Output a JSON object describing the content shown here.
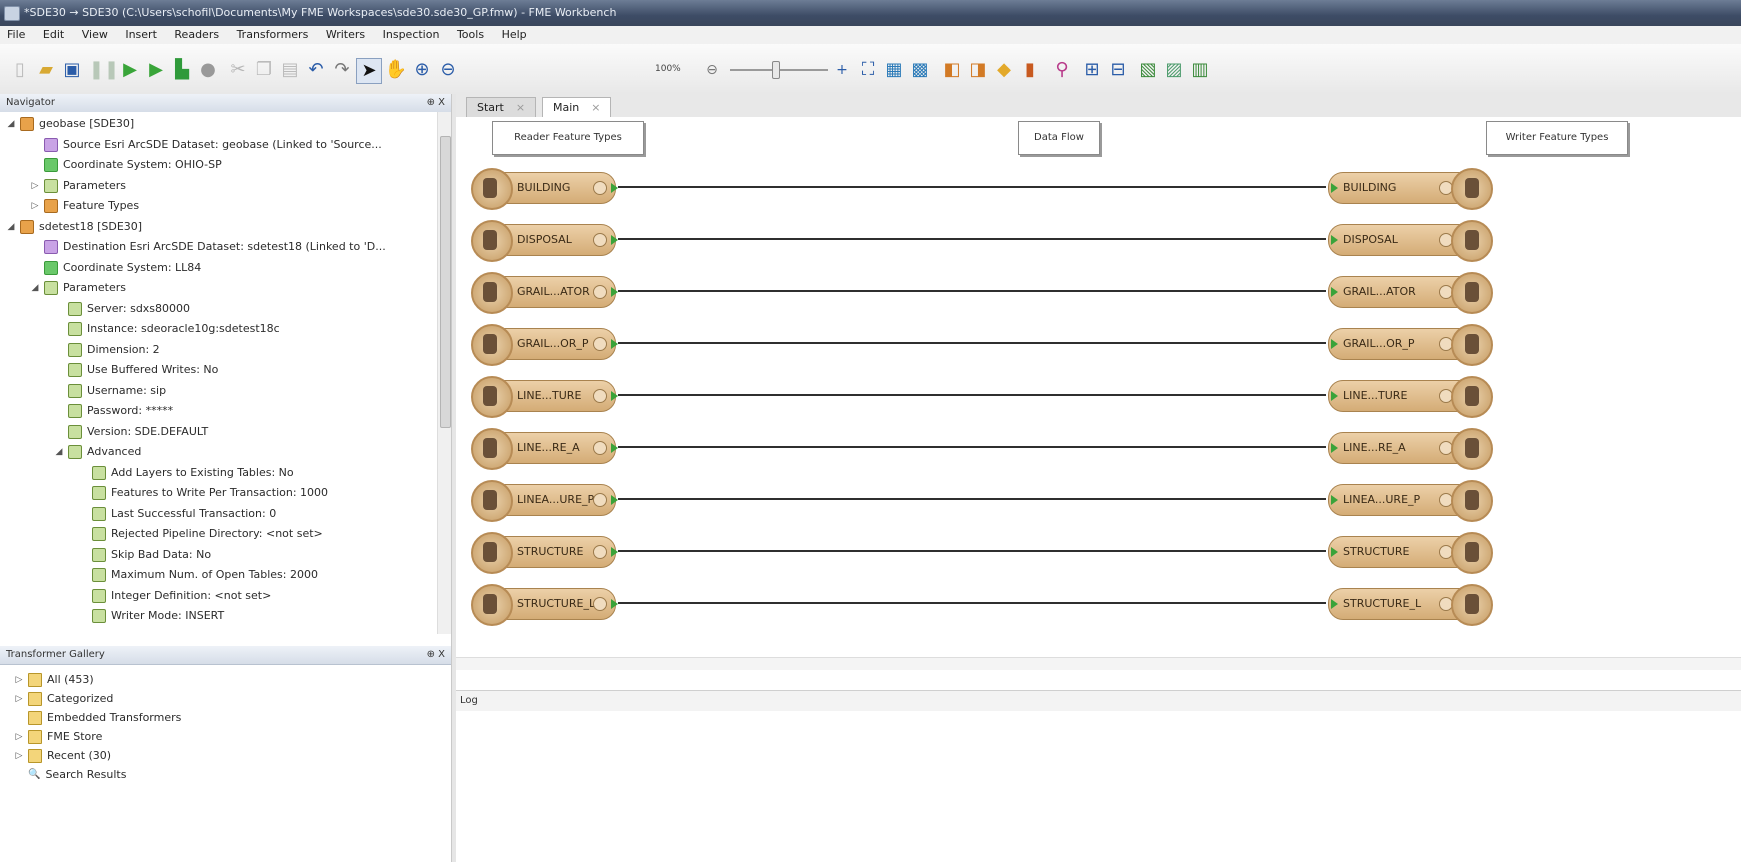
{
  "window": {
    "title": "*SDE30 → SDE30 (C:\\Users\\schofil\\Documents\\My FME Workspaces\\sde30.sde30_GP.fmw) - FME Workbench"
  },
  "menu": [
    "File",
    "Edit",
    "View",
    "Insert",
    "Readers",
    "Transformers",
    "Writers",
    "Inspection",
    "Tools",
    "Help"
  ],
  "toolbar": {
    "zoom_label": "100%",
    "icons": [
      "new-icon",
      "open-icon",
      "save-icon",
      "pause-icon",
      "run-icon",
      "run-to-icon",
      "inspect-icon",
      "stop-icon",
      "cut-icon",
      "copy-icon",
      "paste-icon",
      "undo-icon",
      "redo-icon",
      "select-icon",
      "pan-icon",
      "zoom-in-icon",
      "zoom-out-icon",
      "zoom-minus-icon",
      "zoom-plus-icon",
      "zoom-extents-icon",
      "zoom-fit-icon",
      "refresh-icon",
      "add-reader-icon",
      "add-writer-icon",
      "merge-icon",
      "feature-types-icon",
      "connect-icon",
      "align-icon",
      "layout-icon",
      "publish-icon",
      "report-icon",
      "checkin-icon"
    ]
  },
  "navigator": {
    "header": "Navigator",
    "pin": "⊕ X",
    "items": [
      {
        "label": "geobase [SDE30]",
        "indent": 0,
        "expander": "◢",
        "icon": "orange"
      },
      {
        "label": "Source Esri ArcSDE Dataset: geobase (Linked to 'Source...",
        "indent": 1,
        "expander": "",
        "icon": "purple"
      },
      {
        "label": "Coordinate System: OHIO-SP",
        "indent": 1,
        "expander": "",
        "icon": "green"
      },
      {
        "label": "Parameters",
        "indent": 1,
        "expander": "▷",
        "icon": "gbox"
      },
      {
        "label": "Feature Types",
        "indent": 1,
        "expander": "▷",
        "icon": "orange"
      },
      {
        "label": "sdetest18 [SDE30]",
        "indent": 0,
        "expander": "◢",
        "icon": "orange"
      },
      {
        "label": "Destination Esri ArcSDE Dataset: sdetest18 (Linked to 'D...",
        "indent": 1,
        "expander": "",
        "icon": "purple"
      },
      {
        "label": "Coordinate System: LL84",
        "indent": 1,
        "expander": "",
        "icon": "green"
      },
      {
        "label": "Parameters",
        "indent": 1,
        "expander": "◢",
        "icon": "gbox"
      },
      {
        "label": "Server: sdxs80000",
        "indent": 2,
        "expander": "",
        "icon": "gbox"
      },
      {
        "label": "Instance: sdeoracle10g:sdetest18c",
        "indent": 2,
        "expander": "",
        "icon": "gbox"
      },
      {
        "label": "Dimension: 2",
        "indent": 2,
        "expander": "",
        "icon": "gbox"
      },
      {
        "label": "Use Buffered Writes: No",
        "indent": 2,
        "expander": "",
        "icon": "gbox"
      },
      {
        "label": "Username: sip",
        "indent": 2,
        "expander": "",
        "icon": "gbox"
      },
      {
        "label": "Password: *****",
        "indent": 2,
        "expander": "",
        "icon": "gbox"
      },
      {
        "label": "Version: SDE.DEFAULT",
        "indent": 2,
        "expander": "",
        "icon": "gbox"
      },
      {
        "label": "Advanced",
        "indent": 2,
        "expander": "◢",
        "icon": "gbox"
      },
      {
        "label": "Add Layers to Existing Tables: No",
        "indent": 3,
        "expander": "",
        "icon": "gbox"
      },
      {
        "label": "Features to Write Per Transaction: 1000",
        "indent": 3,
        "expander": "",
        "icon": "gbox"
      },
      {
        "label": "Last Successful Transaction: 0",
        "indent": 3,
        "expander": "",
        "icon": "gbox"
      },
      {
        "label": "Rejected Pipeline Directory: <not set>",
        "indent": 3,
        "expander": "",
        "icon": "gbox"
      },
      {
        "label": "Skip Bad Data: No",
        "indent": 3,
        "expander": "",
        "icon": "gbox"
      },
      {
        "label": "Maximum Num. of Open Tables: 2000",
        "indent": 3,
        "expander": "",
        "icon": "gbox"
      },
      {
        "label": "Integer Definition: <not set>",
        "indent": 3,
        "expander": "",
        "icon": "gbox"
      },
      {
        "label": "Writer Mode: INSERT",
        "indent": 3,
        "expander": "",
        "icon": "gbox"
      }
    ]
  },
  "gallery": {
    "header": "Transformer Gallery",
    "pin": "⊕ X",
    "items": [
      {
        "label": "All (453)",
        "expander": "▷",
        "icon": "folder"
      },
      {
        "label": "Categorized",
        "expander": "▷",
        "icon": "folder"
      },
      {
        "label": "Embedded Transformers",
        "expander": "",
        "icon": "folder"
      },
      {
        "label": "FME Store",
        "expander": "▷",
        "icon": "folder"
      },
      {
        "label": "Recent (30)",
        "expander": "▷",
        "icon": "folder"
      },
      {
        "label": "Search Results",
        "expander": "",
        "icon": "search"
      }
    ]
  },
  "tabs": [
    {
      "label": "Start",
      "close": "×",
      "active": false
    },
    {
      "label": "Main",
      "close": "×",
      "active": true
    }
  ],
  "canvas": {
    "bookmarks": [
      "Reader Feature Types",
      "Data Flow",
      "Writer Feature Types"
    ],
    "readers": [
      "BUILDING",
      "DISPOSAL",
      "GRAIL...ATOR",
      "GRAIL...OR_P",
      "LINE...TURE",
      "LINE...RE_A",
      "LINEA...URE_P",
      "STRUCTURE",
      "STRUCTURE_L"
    ],
    "writers": [
      "BUILDING",
      "DISPOSAL",
      "GRAIL...ATOR",
      "GRAIL...OR_P",
      "LINE...TURE",
      "LINE...RE_A",
      "LINEA...URE_P",
      "STRUCTURE",
      "STRUCTURE_L"
    ]
  },
  "log": {
    "header": "Log"
  }
}
